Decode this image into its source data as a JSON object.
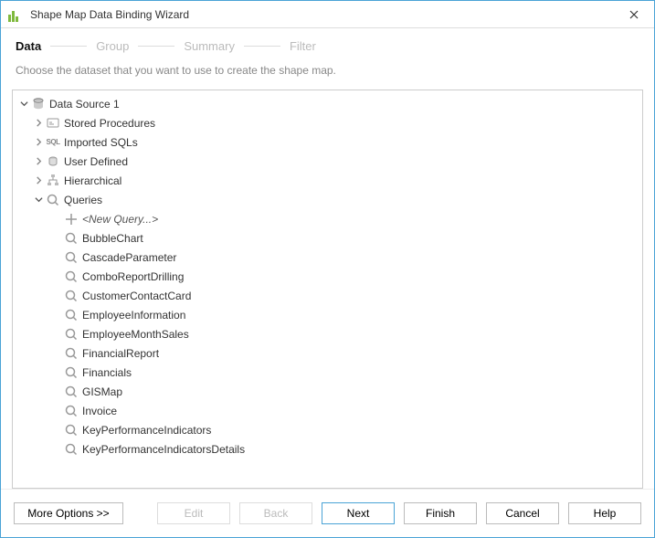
{
  "window": {
    "title": "Shape Map Data Binding Wizard"
  },
  "steps": [
    {
      "label": "Data",
      "active": true
    },
    {
      "label": "Group",
      "active": false
    },
    {
      "label": "Summary",
      "active": false
    },
    {
      "label": "Filter",
      "active": false
    }
  ],
  "instruction": "Choose the dataset that you want to use to create the shape map.",
  "tree": {
    "root": {
      "label": "Data Source 1",
      "expanded": true
    },
    "children": [
      {
        "id": "stored-procedures",
        "label": "Stored Procedures",
        "icon": "stored-proc-icon",
        "expanded": false
      },
      {
        "id": "imported-sqls",
        "label": "Imported SQLs",
        "icon": "sql-icon",
        "expanded": false
      },
      {
        "id": "user-defined",
        "label": "User Defined",
        "icon": "user-defined-icon",
        "expanded": false
      },
      {
        "id": "hierarchical",
        "label": "Hierarchical",
        "icon": "hierarchical-icon",
        "expanded": false
      },
      {
        "id": "queries",
        "label": "Queries",
        "icon": "query-icon",
        "expanded": true
      }
    ],
    "queries_new": "<New Query...>",
    "queries": [
      "BubbleChart",
      "CascadeParameter",
      "ComboReportDrilling",
      "CustomerContactCard",
      "EmployeeInformation",
      "EmployeeMonthSales",
      "FinancialReport",
      "Financials",
      "GISMap",
      "Invoice",
      "KeyPerformanceIndicators",
      "KeyPerformanceIndicatorsDetails"
    ]
  },
  "footer": {
    "more_options": "More Options >>",
    "edit": "Edit",
    "back": "Back",
    "next": "Next",
    "finish": "Finish",
    "cancel": "Cancel",
    "help": "Help"
  }
}
